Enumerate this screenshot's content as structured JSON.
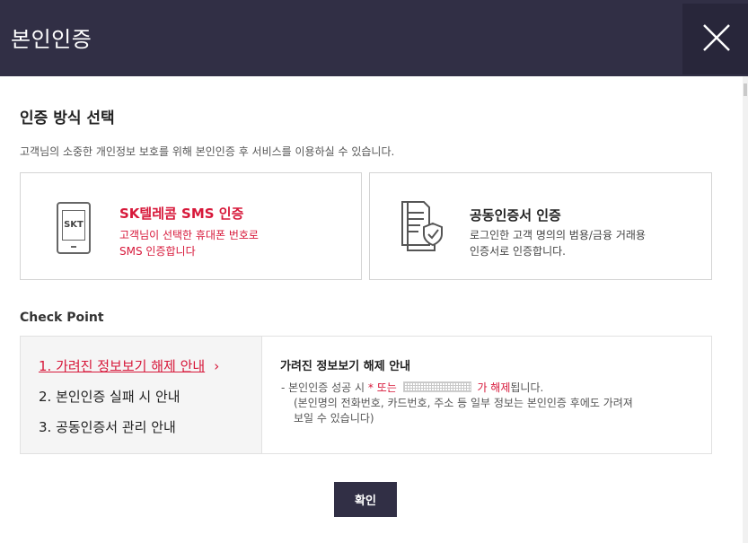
{
  "header": {
    "title": "본인인증",
    "close_icon": "close-icon"
  },
  "method": {
    "title": "인증 방식 선택",
    "description": "고객님의 소중한 개인정보 보호를 위해 본인인증 후 서비스를 이용하실 수 있습니다.",
    "sms": {
      "icon_label": "SKT",
      "name": "SK텔레콤 SMS 인증",
      "line1": "고객님이 선택한 휴대폰 번호로",
      "line2": "SMS 인증합니다",
      "icon": "phone-icon"
    },
    "cert": {
      "name": "공동인증서 인증",
      "line1": "로그인한 고객 명의의 범용/금융 거래용",
      "line2": "인증서로 인증합니다.",
      "icon": "certificate-icon"
    }
  },
  "checkpoint": {
    "title": "Check Point",
    "items": [
      {
        "label": "1. 가려진 정보보기 해제 안내",
        "active": true
      },
      {
        "label": "2. 본인인증 실패 시 안내",
        "active": false
      },
      {
        "label": "3. 공동인증서 관리 안내",
        "active": false
      }
    ],
    "chevron": "›",
    "detail": {
      "title": "가려진 정보보기 해제 안내",
      "line1_prefix": "-  본인인증 성공 시",
      "line1_star": "* 또는",
      "line1_released": "가 해제",
      "line1_suffix": "됩니다.",
      "line2": "(본인명의 전화번호, 카드번호, 주소 등 일부 정보는 본인인증 후에도 가려져",
      "line3": "보일 수 있습니다)"
    }
  },
  "confirm_label": "확인",
  "colors": {
    "header_bg": "#312f45",
    "accent": "#d7183a"
  }
}
